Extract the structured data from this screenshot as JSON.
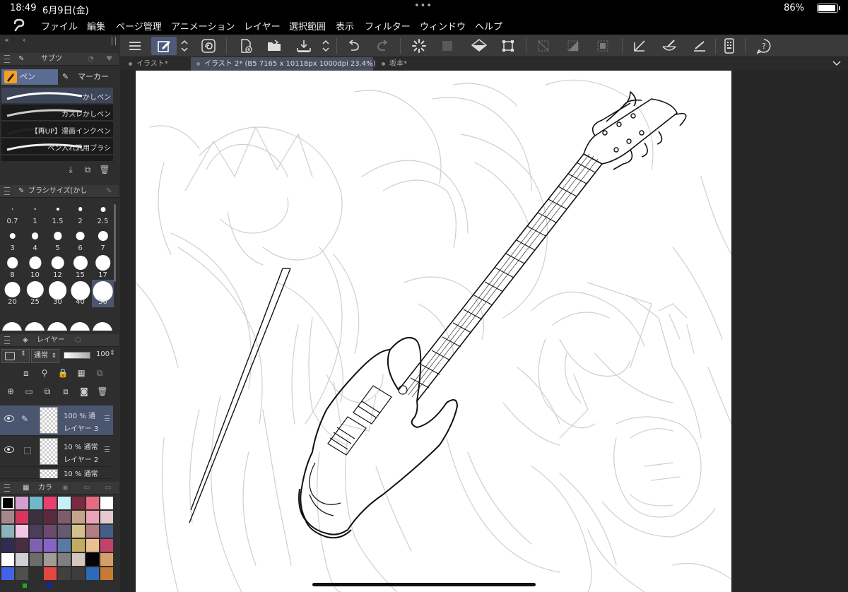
{
  "status_bar": {
    "time": "18:49",
    "date": "6月9日(金)",
    "battery": "86%"
  },
  "menubar": {
    "items": [
      "ファイル",
      "編集",
      "ページ管理",
      "アニメーション",
      "レイヤー",
      "選択範囲",
      "表示",
      "フィルター",
      "ウィンドウ",
      "ヘルプ"
    ]
  },
  "tabs": [
    {
      "label": "イラスト*"
    },
    {
      "label": "イラスト 2* (B5 7165 x 10118px 1000dpi 23.4%)"
    },
    {
      "label": "坂本*"
    }
  ],
  "left_panel": {
    "tool_tabs": [
      "サブツ"
    ],
    "sub_tools": [
      "ペン",
      "マーカー"
    ],
    "brushes": [
      "かしペン",
      "カスレかしペン",
      "【再UP】漫画インクペン",
      "ペン入れ汎用ブラシ"
    ],
    "brush_size_header": "ブラシサイズ[かし",
    "brush_sizes": [
      {
        "label": "0.7"
      },
      {
        "label": "1"
      },
      {
        "label": "1.5"
      },
      {
        "label": "2"
      },
      {
        "label": "2.5"
      },
      {
        "label": "3"
      },
      {
        "label": "4"
      },
      {
        "label": "5"
      },
      {
        "label": "6"
      },
      {
        "label": "7"
      },
      {
        "label": "8"
      },
      {
        "label": "10"
      },
      {
        "label": "12"
      },
      {
        "label": "15"
      },
      {
        "label": "17"
      },
      {
        "label": "20"
      },
      {
        "label": "25"
      },
      {
        "label": "30"
      },
      {
        "label": "40"
      },
      {
        "label": "50"
      }
    ],
    "selected_brush_size": "50",
    "layer_header": "レイヤー",
    "blend_mode": "通常",
    "opacity_value": "100",
    "layers": [
      {
        "opacity": "100 %",
        "mode": "通",
        "name": "レイヤー 3",
        "selected": true
      },
      {
        "opacity": "10 %",
        "mode": "通常",
        "name": "レイヤー 2",
        "selected": false
      },
      {
        "opacity": "10 %",
        "mode": "通常",
        "name": "",
        "selected": false
      }
    ],
    "color_header": "カラ",
    "palette": [
      "#000000",
      "#d39fd1",
      "#6fb7c9",
      "#e8406f",
      "#c6f0f7",
      "#7b2a3f",
      "#e56b7e",
      "#ffffff",
      "#a5878b",
      "#d6365d",
      "#3b2f42",
      "#5c2a3d",
      "#7f5c6a",
      "#c2a58b",
      "#e8a4b6",
      "#e5c8d0",
      "#8bb3bd",
      "#f1c6e8",
      "#4d3d5b",
      "#6d4970",
      "#675a6e",
      "#d4c08a",
      "#b17c82",
      "#445d84",
      "#2e2c52",
      "#4a2d42",
      "#7e62b1",
      "#8864c8",
      "#587aa4",
      "#c1ad5d",
      "#e9c08e",
      "#c1426b",
      "#ffffff",
      "#cfd1d6",
      "#6c6c6c",
      "#a39b95",
      "#7f7f7f",
      "#d3c8bf",
      "#050505",
      "#d49f69",
      "#4462e6",
      "#4f4f4f",
      "#2e2e2e",
      "#e24743",
      "#404040",
      "#3d3d3d",
      "#2d6bb8",
      "#c77a31"
    ],
    "bottom_colors": [
      "#22aa22",
      "#1122cc"
    ]
  }
}
